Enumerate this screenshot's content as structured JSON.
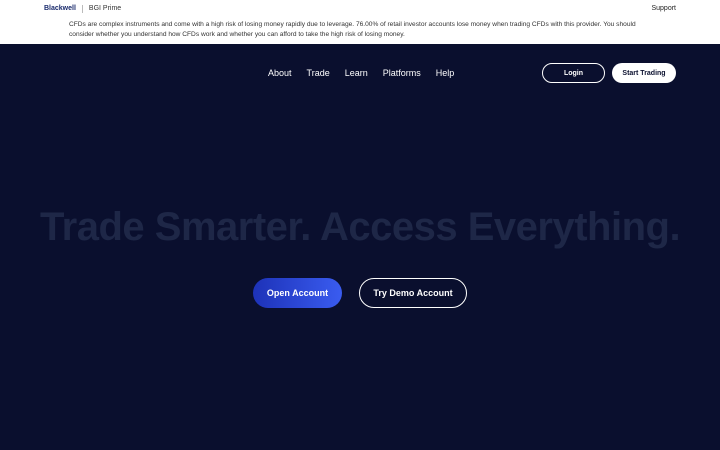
{
  "topbar": {
    "brand_primary": "Blackwell",
    "brand_secondary": "BGI Prime",
    "support_label": "Support",
    "risk_warning": "CFDs are complex instruments and come with a high risk of losing money rapidly due to leverage. 76.00% of retail investor accounts lose money when trading CFDs with this provider. You should consider whether you understand how CFDs work and whether you can afford to take the high risk of losing money."
  },
  "nav": {
    "items": [
      {
        "label": "About"
      },
      {
        "label": "Trade"
      },
      {
        "label": "Learn"
      },
      {
        "label": "Platforms"
      },
      {
        "label": "Help"
      }
    ],
    "login_label": "Login",
    "start_label": "Start Trading"
  },
  "hero": {
    "headline": "Trade Smarter. Access Everything.",
    "open_account_label": "Open Account",
    "demo_account_label": "Try Demo Account"
  },
  "colors": {
    "background": "#0a0f2e",
    "headline": "#1e2747",
    "accent": "#3a5cf0",
    "brand": "#1a2b6d"
  }
}
